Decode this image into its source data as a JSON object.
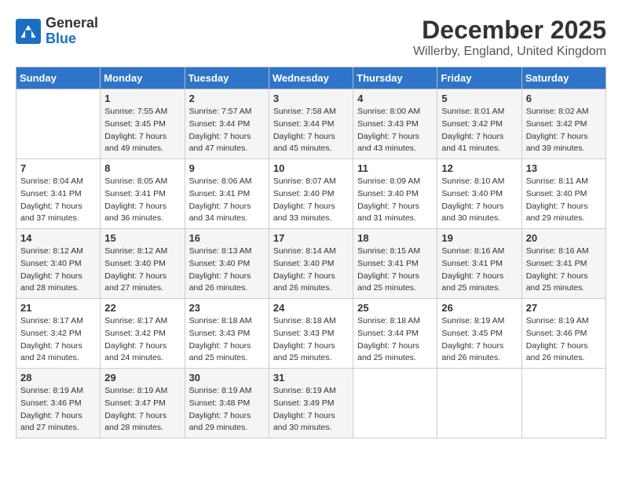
{
  "header": {
    "logo": {
      "general": "General",
      "blue": "Blue"
    },
    "title": "December 2025",
    "subtitle": "Willerby, England, United Kingdom"
  },
  "weekdays": [
    "Sunday",
    "Monday",
    "Tuesday",
    "Wednesday",
    "Thursday",
    "Friday",
    "Saturday"
  ],
  "weeks": [
    [
      {
        "day": "",
        "info": ""
      },
      {
        "day": "1",
        "info": "Sunrise: 7:55 AM\nSunset: 3:45 PM\nDaylight: 7 hours\nand 49 minutes."
      },
      {
        "day": "2",
        "info": "Sunrise: 7:57 AM\nSunset: 3:44 PM\nDaylight: 7 hours\nand 47 minutes."
      },
      {
        "day": "3",
        "info": "Sunrise: 7:58 AM\nSunset: 3:44 PM\nDaylight: 7 hours\nand 45 minutes."
      },
      {
        "day": "4",
        "info": "Sunrise: 8:00 AM\nSunset: 3:43 PM\nDaylight: 7 hours\nand 43 minutes."
      },
      {
        "day": "5",
        "info": "Sunrise: 8:01 AM\nSunset: 3:42 PM\nDaylight: 7 hours\nand 41 minutes."
      },
      {
        "day": "6",
        "info": "Sunrise: 8:02 AM\nSunset: 3:42 PM\nDaylight: 7 hours\nand 39 minutes."
      }
    ],
    [
      {
        "day": "7",
        "info": "Sunrise: 8:04 AM\nSunset: 3:41 PM\nDaylight: 7 hours\nand 37 minutes."
      },
      {
        "day": "8",
        "info": "Sunrise: 8:05 AM\nSunset: 3:41 PM\nDaylight: 7 hours\nand 36 minutes."
      },
      {
        "day": "9",
        "info": "Sunrise: 8:06 AM\nSunset: 3:41 PM\nDaylight: 7 hours\nand 34 minutes."
      },
      {
        "day": "10",
        "info": "Sunrise: 8:07 AM\nSunset: 3:40 PM\nDaylight: 7 hours\nand 33 minutes."
      },
      {
        "day": "11",
        "info": "Sunrise: 8:09 AM\nSunset: 3:40 PM\nDaylight: 7 hours\nand 31 minutes."
      },
      {
        "day": "12",
        "info": "Sunrise: 8:10 AM\nSunset: 3:40 PM\nDaylight: 7 hours\nand 30 minutes."
      },
      {
        "day": "13",
        "info": "Sunrise: 8:11 AM\nSunset: 3:40 PM\nDaylight: 7 hours\nand 29 minutes."
      }
    ],
    [
      {
        "day": "14",
        "info": "Sunrise: 8:12 AM\nSunset: 3:40 PM\nDaylight: 7 hours\nand 28 minutes."
      },
      {
        "day": "15",
        "info": "Sunrise: 8:12 AM\nSunset: 3:40 PM\nDaylight: 7 hours\nand 27 minutes."
      },
      {
        "day": "16",
        "info": "Sunrise: 8:13 AM\nSunset: 3:40 PM\nDaylight: 7 hours\nand 26 minutes."
      },
      {
        "day": "17",
        "info": "Sunrise: 8:14 AM\nSunset: 3:40 PM\nDaylight: 7 hours\nand 26 minutes."
      },
      {
        "day": "18",
        "info": "Sunrise: 8:15 AM\nSunset: 3:41 PM\nDaylight: 7 hours\nand 25 minutes."
      },
      {
        "day": "19",
        "info": "Sunrise: 8:16 AM\nSunset: 3:41 PM\nDaylight: 7 hours\nand 25 minutes."
      },
      {
        "day": "20",
        "info": "Sunrise: 8:16 AM\nSunset: 3:41 PM\nDaylight: 7 hours\nand 25 minutes."
      }
    ],
    [
      {
        "day": "21",
        "info": "Sunrise: 8:17 AM\nSunset: 3:42 PM\nDaylight: 7 hours\nand 24 minutes."
      },
      {
        "day": "22",
        "info": "Sunrise: 8:17 AM\nSunset: 3:42 PM\nDaylight: 7 hours\nand 24 minutes."
      },
      {
        "day": "23",
        "info": "Sunrise: 8:18 AM\nSunset: 3:43 PM\nDaylight: 7 hours\nand 25 minutes."
      },
      {
        "day": "24",
        "info": "Sunrise: 8:18 AM\nSunset: 3:43 PM\nDaylight: 7 hours\nand 25 minutes."
      },
      {
        "day": "25",
        "info": "Sunrise: 8:18 AM\nSunset: 3:44 PM\nDaylight: 7 hours\nand 25 minutes."
      },
      {
        "day": "26",
        "info": "Sunrise: 8:19 AM\nSunset: 3:45 PM\nDaylight: 7 hours\nand 26 minutes."
      },
      {
        "day": "27",
        "info": "Sunrise: 8:19 AM\nSunset: 3:46 PM\nDaylight: 7 hours\nand 26 minutes."
      }
    ],
    [
      {
        "day": "28",
        "info": "Sunrise: 8:19 AM\nSunset: 3:46 PM\nDaylight: 7 hours\nand 27 minutes."
      },
      {
        "day": "29",
        "info": "Sunrise: 8:19 AM\nSunset: 3:47 PM\nDaylight: 7 hours\nand 28 minutes."
      },
      {
        "day": "30",
        "info": "Sunrise: 8:19 AM\nSunset: 3:48 PM\nDaylight: 7 hours\nand 29 minutes."
      },
      {
        "day": "31",
        "info": "Sunrise: 8:19 AM\nSunset: 3:49 PM\nDaylight: 7 hours\nand 30 minutes."
      },
      {
        "day": "",
        "info": ""
      },
      {
        "day": "",
        "info": ""
      },
      {
        "day": "",
        "info": ""
      }
    ]
  ]
}
